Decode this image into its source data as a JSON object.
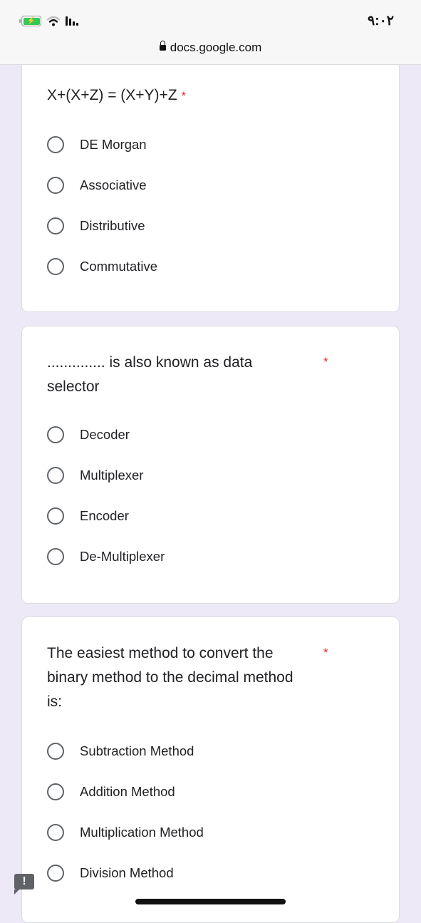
{
  "status_bar": {
    "time": "٩:٠٢",
    "battery_icon": "battery-charging-icon",
    "wifi_icon": "wifi-icon",
    "signal_icon": "signal-bars-icon"
  },
  "browser": {
    "url": "docs.google.com",
    "lock_icon": "lock-icon"
  },
  "colors": {
    "background": "#ede9f6",
    "required": "#d93025",
    "radio_border": "#5f6368"
  },
  "questions": [
    {
      "title": "X+(X+Z) = (X+Y)+Z",
      "required_mark": "*",
      "options": [
        "DE Morgan",
        "Associative",
        "Distributive",
        "Commutative"
      ]
    },
    {
      "title": ".............. is also known as data selector",
      "required_mark": "*",
      "options": [
        "Decoder",
        "Multiplexer",
        "Encoder",
        "De-Multiplexer"
      ]
    },
    {
      "title": "The easiest method to convert the binary method to the decimal method is:",
      "required_mark": "*",
      "options": [
        "Subtraction Method",
        "Addition Method",
        "Multiplication Method",
        "Division Method"
      ]
    }
  ],
  "feedback": {
    "label": "!",
    "icon": "report-feedback-icon"
  }
}
